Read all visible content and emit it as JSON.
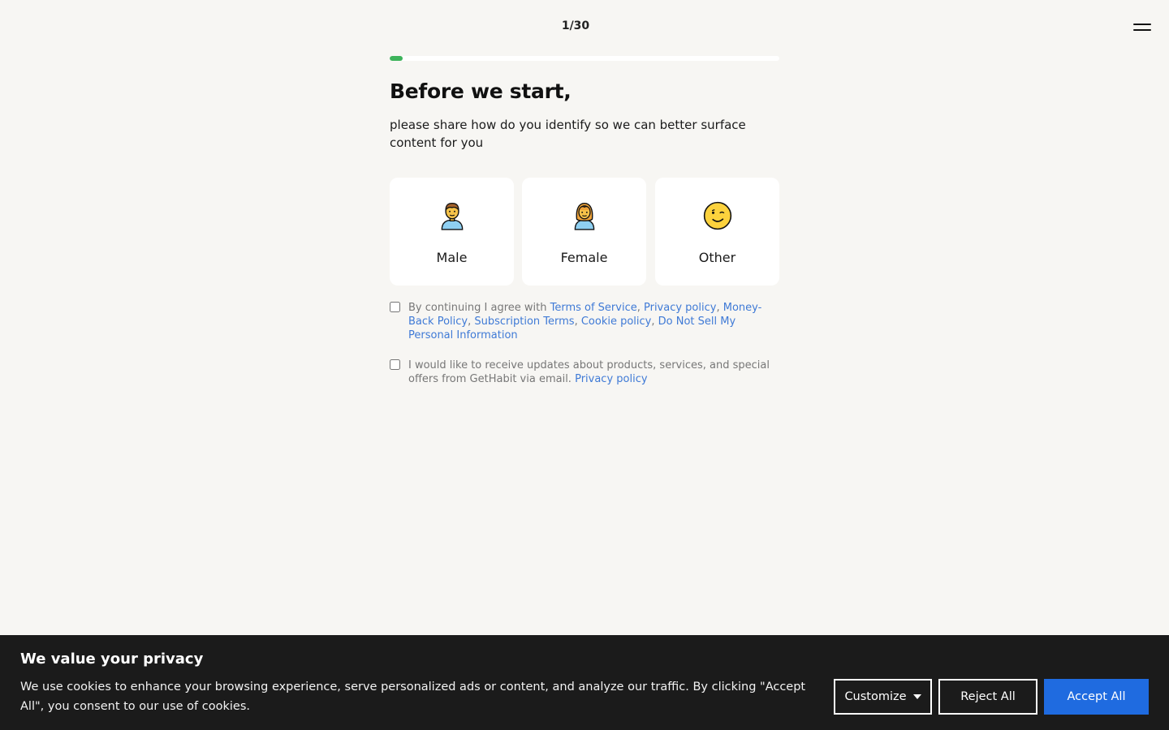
{
  "header": {
    "step_counter": "1/30",
    "progress": 0.033
  },
  "intro": {
    "headline": "Before we start,",
    "subtitle": "please share how do you identify so we can better surface content for you"
  },
  "options": [
    {
      "label": "Male",
      "icon": "man-emoji-icon"
    },
    {
      "label": "Female",
      "icon": "woman-emoji-icon"
    },
    {
      "label": "Other",
      "icon": "winking-face-icon"
    }
  ],
  "consent": {
    "terms_prefix": "By continuing I agree with ",
    "terms_links": [
      "Terms of Service",
      "Privacy policy",
      "Money-Back Policy",
      "Subscription Terms",
      "Cookie policy",
      "Do Not Sell My Personal Information"
    ],
    "terms_separator": ", ",
    "marketing_text": "I would like to receive updates about products, services, and special offers from GetHabit via email. ",
    "marketing_link": "Privacy policy"
  },
  "cookie_banner": {
    "title": "We value your privacy",
    "text": "We use cookies to enhance your browsing experience, serve personalized ads or content, and analyze our traffic. By clicking \"Accept All\", you consent to our use of cookies.",
    "customize_label": "Customize",
    "reject_label": "Reject All",
    "accept_label": "Accept All"
  },
  "colors": {
    "background": "#f7f6f3",
    "progress_fill": "#3db35b",
    "link": "#3f7ad6",
    "banner_bg": "#1b1b1b",
    "accept_button": "#1f6be0"
  }
}
